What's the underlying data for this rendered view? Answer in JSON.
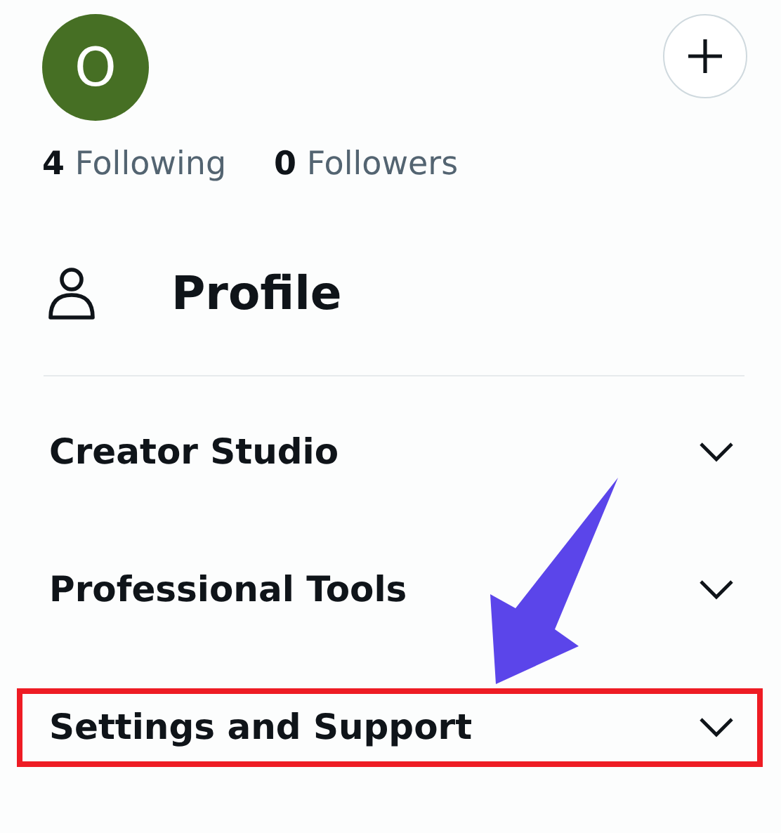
{
  "avatar": {
    "letter": "O"
  },
  "stats": [
    {
      "count": "4",
      "label": "Following"
    },
    {
      "count": "0",
      "label": "Followers"
    }
  ],
  "profile_link": {
    "label": "Profile"
  },
  "sections": [
    {
      "label": "Creator Studio",
      "expanded": false,
      "highlighted": false
    },
    {
      "label": "Professional Tools",
      "expanded": false,
      "highlighted": false
    },
    {
      "label": "Settings and Support",
      "expanded": false,
      "highlighted": true
    }
  ],
  "annotation_arrow": {
    "visible": true
  }
}
